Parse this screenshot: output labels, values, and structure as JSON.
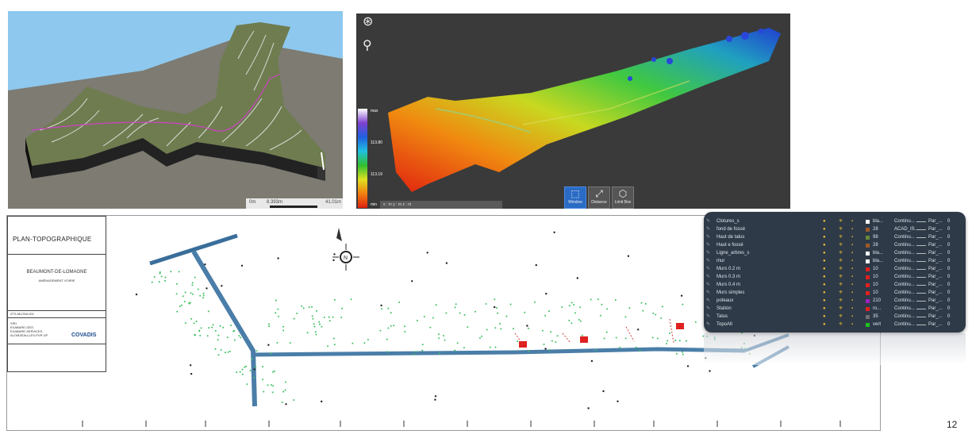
{
  "terrain": {
    "scale_label": "0m",
    "scale_value": "8.393m",
    "scale_end": "41.01m"
  },
  "pointcloud": {
    "legend": [
      "max",
      "113.80",
      "113.19",
      "min"
    ],
    "coords": "x : m      y : m      z : m",
    "tools": [
      {
        "label": "Window",
        "icon": "window-select-icon",
        "active": true
      },
      {
        "label": "Distance",
        "icon": "distance-icon",
        "active": false
      },
      {
        "label": "Limit Box",
        "icon": "limit-box-icon",
        "active": false
      }
    ]
  },
  "plan": {
    "title": "PLAN-TOPOGRAPHIQUE",
    "place": "BEAUMONT-DE-LOMAGNE",
    "subtitle": "AMÉNAGEMENT VOIRIE",
    "ref": "ZTS-MUTMI-001",
    "company_lines": [
      "SIRI",
      "EXABARE-GÉO",
      "EXABARE-SERVICES",
      "ALOMZEAU-LES-PVR UP"
    ],
    "logo": "COVADIS"
  },
  "layers": [
    {
      "name": "Clotures_s",
      "color": "#ffffff",
      "color_name": "bla...",
      "linetype": "Continu...",
      "lineweight": "Par_...",
      "trans": "0"
    },
    {
      "name": "fond de fossé",
      "color": "#a05a28",
      "color_name": "28",
      "linetype": "ACAD_IS...",
      "lineweight": "Par_...",
      "trans": "0"
    },
    {
      "name": "Haut de talus",
      "color": "#6a8a3a",
      "color_name": "98",
      "linetype": "Continu...",
      "lineweight": "Par_...",
      "trans": "0"
    },
    {
      "name": "Haut e fossé",
      "color": "#a05a28",
      "color_name": "28",
      "linetype": "Continu...",
      "lineweight": "Par_...",
      "trans": "0"
    },
    {
      "name": "Ligne_arbres_s",
      "color": "#ffffff",
      "color_name": "bla...",
      "linetype": "Continu...",
      "lineweight": "Par_...",
      "trans": "0"
    },
    {
      "name": "mur",
      "color": "#ffffff",
      "color_name": "bla...",
      "linetype": "Continu...",
      "lineweight": "Par_...",
      "trans": "0"
    },
    {
      "name": "Murs 0.2 m",
      "color": "#e02020",
      "color_name": "10",
      "linetype": "Continu...",
      "lineweight": "Par_...",
      "trans": "0"
    },
    {
      "name": "Murs 0.3 m",
      "color": "#e02020",
      "color_name": "10",
      "linetype": "Continu...",
      "lineweight": "Par_...",
      "trans": "0"
    },
    {
      "name": "Murs 0.4 m",
      "color": "#e02020",
      "color_name": "10",
      "linetype": "Continu...",
      "lineweight": "Par_...",
      "trans": "0"
    },
    {
      "name": "Murs simples",
      "color": "#e02020",
      "color_name": "10",
      "linetype": "Continu...",
      "lineweight": "Par_...",
      "trans": "0"
    },
    {
      "name": "poteaux",
      "color": "#a020c0",
      "color_name": "210",
      "linetype": "Continu...",
      "lineweight": "Par_...",
      "trans": "0"
    },
    {
      "name": "Station",
      "color": "#e02020",
      "color_name": "ro...",
      "linetype": "Continu...",
      "lineweight": "Par_...",
      "trans": "0"
    },
    {
      "name": "Talus",
      "color": "#707070",
      "color_name": "35",
      "linetype": "Continu...",
      "lineweight": "Par_...",
      "trans": "0"
    },
    {
      "name": "TopoAlt",
      "color": "#20c020",
      "color_name": "vert",
      "linetype": "Continu...",
      "lineweight": "Par_...",
      "trans": "0"
    }
  ],
  "page_number": "12"
}
